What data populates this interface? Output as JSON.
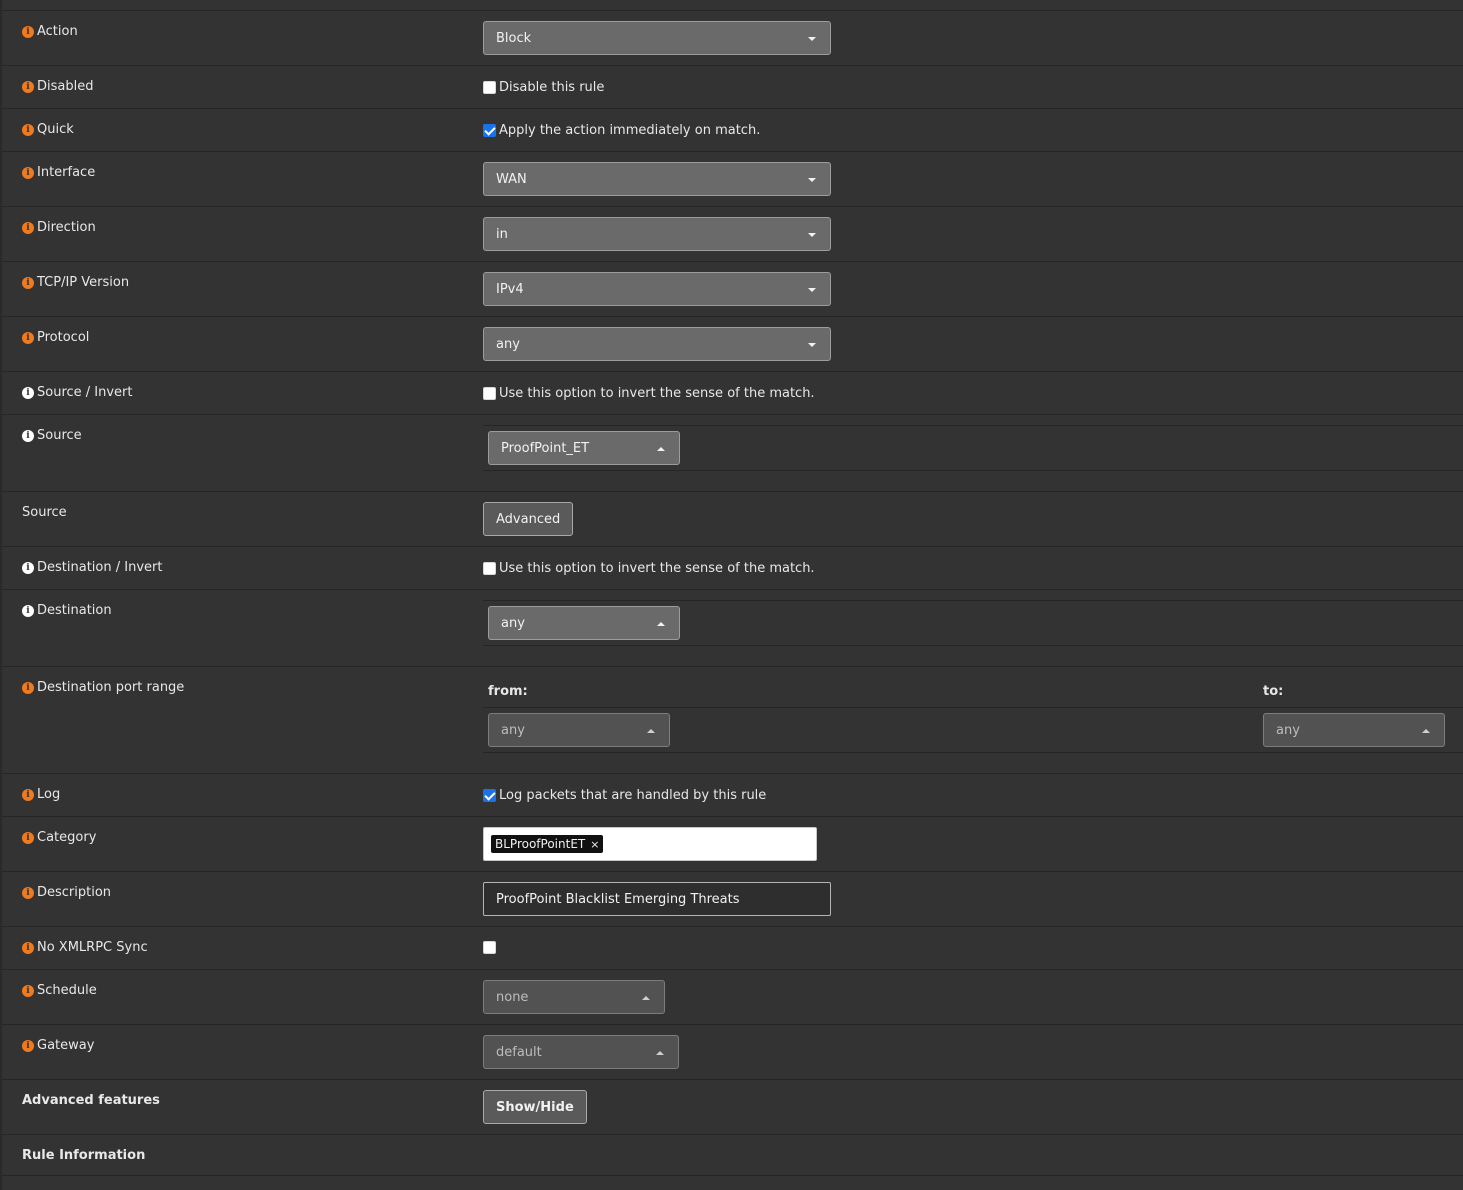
{
  "rows": {
    "action": {
      "label": "Action",
      "value": "Block"
    },
    "disabled": {
      "label": "Disabled",
      "text": "Disable this rule"
    },
    "quick": {
      "label": "Quick",
      "text": "Apply the action immediately on match."
    },
    "interface": {
      "label": "Interface",
      "value": "WAN"
    },
    "direction": {
      "label": "Direction",
      "value": "in"
    },
    "ipversion": {
      "label": "TCP/IP Version",
      "value": "IPv4"
    },
    "protocol": {
      "label": "Protocol",
      "value": "any"
    },
    "source_invert": {
      "label": "Source / Invert",
      "text": "Use this option to invert the sense of the match."
    },
    "source": {
      "label": "Source",
      "value": "ProofPoint_ET"
    },
    "source_adv": {
      "label": "Source",
      "button": "Advanced"
    },
    "dest_invert": {
      "label": "Destination / Invert",
      "text": "Use this option to invert the sense of the match."
    },
    "destination": {
      "label": "Destination",
      "value": "any"
    },
    "dest_port": {
      "label": "Destination port range",
      "from_label": "from:",
      "from_value": "any",
      "to_label": "to:",
      "to_value": "any"
    },
    "log": {
      "label": "Log",
      "text": "Log packets that are handled by this rule"
    },
    "category": {
      "label": "Category",
      "tag": "BLProofPointET",
      "tag_remove": "×"
    },
    "description": {
      "label": "Description",
      "value": "ProofPoint Blacklist Emerging Threats"
    },
    "noxmlrpc": {
      "label": "No XMLRPC Sync"
    },
    "schedule": {
      "label": "Schedule",
      "value": "none"
    },
    "gateway": {
      "label": "Gateway",
      "value": "default"
    },
    "advanced": {
      "label": "Advanced features",
      "button": "Show/Hide"
    },
    "rule_info": {
      "label": "Rule Information"
    }
  },
  "icons": {
    "info": "i"
  },
  "colors": {
    "background": "#333333",
    "info_orange": "#f07a1e",
    "checkbox_checked": "#1a73e8"
  }
}
